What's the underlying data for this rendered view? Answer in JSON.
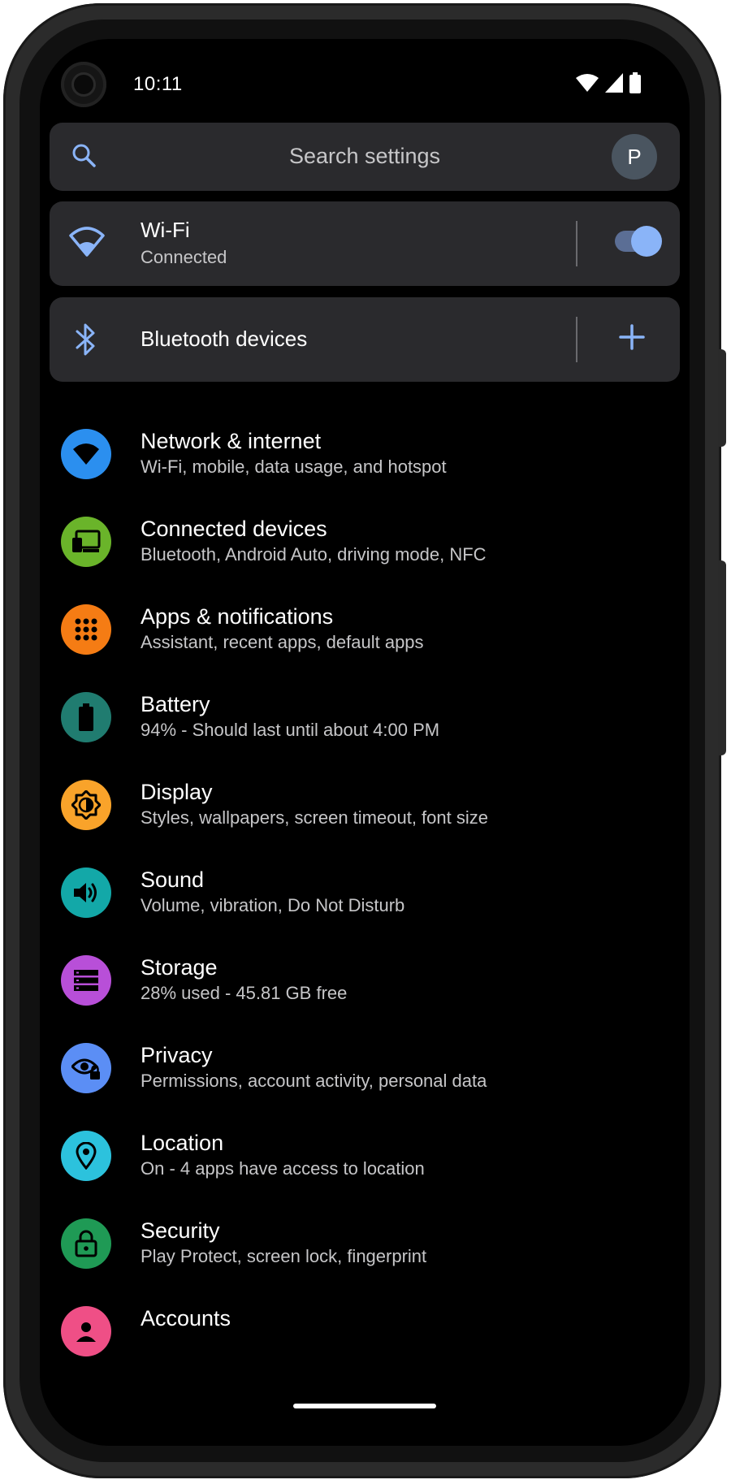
{
  "status_bar": {
    "time": "10:11"
  },
  "search": {
    "placeholder": "Search settings",
    "avatar_letter": "P"
  },
  "wifi": {
    "title": "Wi-Fi",
    "status": "Connected",
    "toggle_on": true
  },
  "bluetooth": {
    "title": "Bluetooth devices"
  },
  "items": [
    {
      "title": "Network & internet",
      "subtitle": "Wi-Fi, mobile, data usage, and hotspot",
      "icon": "wifi-icon",
      "color": "#2b8fef"
    },
    {
      "title": "Connected devices",
      "subtitle": "Bluetooth, Android Auto, driving mode, NFC",
      "icon": "devices-icon",
      "color": "#6ab42a"
    },
    {
      "title": "Apps & notifications",
      "subtitle": "Assistant, recent apps, default apps",
      "icon": "apps-grid-icon",
      "color": "#f57c14"
    },
    {
      "title": "Battery",
      "subtitle": "94% - Should last until about 4:00 PM",
      "icon": "battery-icon",
      "color": "#207c70"
    },
    {
      "title": "Display",
      "subtitle": "Styles, wallpapers, screen timeout, font size",
      "icon": "brightness-icon",
      "color": "#f9a32a"
    },
    {
      "title": "Sound",
      "subtitle": "Volume, vibration, Do Not Disturb",
      "icon": "speaker-icon",
      "color": "#13a8a8"
    },
    {
      "title": "Storage",
      "subtitle": "28% used - 45.81 GB free",
      "icon": "storage-icon",
      "color": "#b84fd8"
    },
    {
      "title": "Privacy",
      "subtitle": "Permissions, account activity, personal data",
      "icon": "privacy-eye-icon",
      "color": "#5b8ef5"
    },
    {
      "title": "Location",
      "subtitle": "On - 4 apps have access to location",
      "icon": "location-pin-icon",
      "color": "#2cc2dd"
    },
    {
      "title": "Security",
      "subtitle": "Play Protect, screen lock, fingerprint",
      "icon": "lock-icon",
      "color": "#1f9a55"
    },
    {
      "title": "Accounts",
      "subtitle": "",
      "icon": "account-icon",
      "color": "#ef4f86"
    }
  ]
}
